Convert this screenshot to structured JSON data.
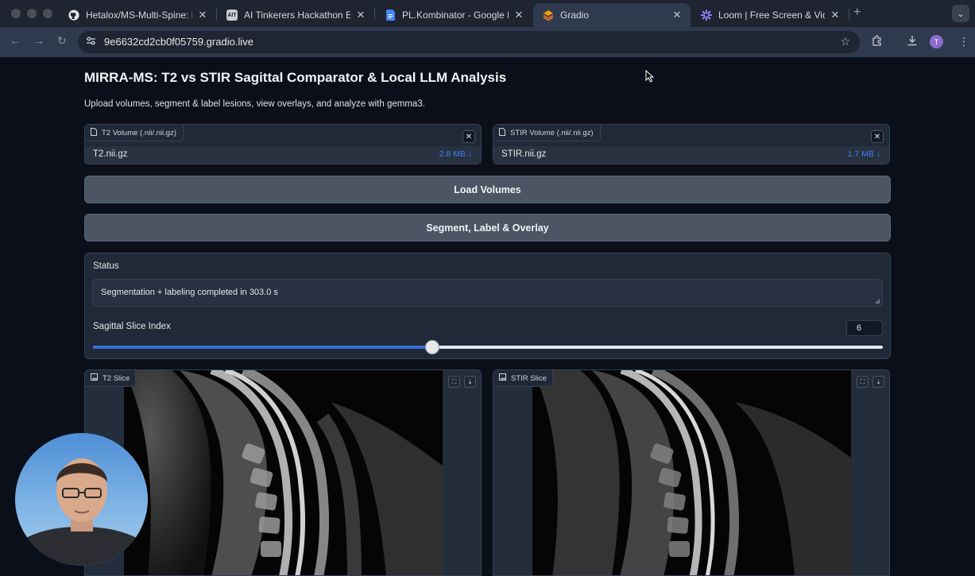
{
  "browser": {
    "tabs": [
      {
        "title": "Hetalox/MS-Multi-Spine: Multi",
        "favicon": "github-icon"
      },
      {
        "title": "AI Tinkerers Hackathon Entrie",
        "favicon": "ait-icon",
        "favicon_text": "AIT"
      },
      {
        "title": "PL.Kombinator - Google Docs",
        "favicon": "docs-icon"
      },
      {
        "title": "Gradio",
        "favicon": "gradio-icon",
        "active": true
      },
      {
        "title": "Loom | Free Screen & Video R",
        "favicon": "loom-icon"
      }
    ],
    "new_tab": "+",
    "tab_menu": "⌄",
    "url": "9e6632cd2cb0f05759.gradio.live",
    "profile_initial": "T"
  },
  "app": {
    "title": "MIRRA-MS: T2 vs STIR Sagittal Comparator & Local LLM Analysis",
    "subtitle": "Upload volumes, segment & label lesions, view overlays, and analyze with gemma3.",
    "t2_upload": {
      "label": "T2 Volume (.nii/.nii.gz)",
      "filename": "T2.nii.gz",
      "size": "2.8 MB ↓"
    },
    "stir_upload": {
      "label": "STIR Volume (.nii/.nii.gz)",
      "filename": "STIR.nii.gz",
      "size": "1.7 MB ↓"
    },
    "load_button": "Load Volumes",
    "segment_button": "Segment, Label & Overlay",
    "status": {
      "label": "Status",
      "value": "Segmentation + labeling completed in 303.0 s"
    },
    "slider": {
      "label": "Sagittal Slice Index",
      "value": "6",
      "fraction": 0.43
    },
    "t2_image": {
      "label": "T2 Slice"
    },
    "stir_image": {
      "label": "STIR Slice"
    }
  },
  "colors": {
    "accent": "#3b82f6",
    "panel": "#1f2937",
    "background": "#0b0f19",
    "button": "#4b5563"
  }
}
